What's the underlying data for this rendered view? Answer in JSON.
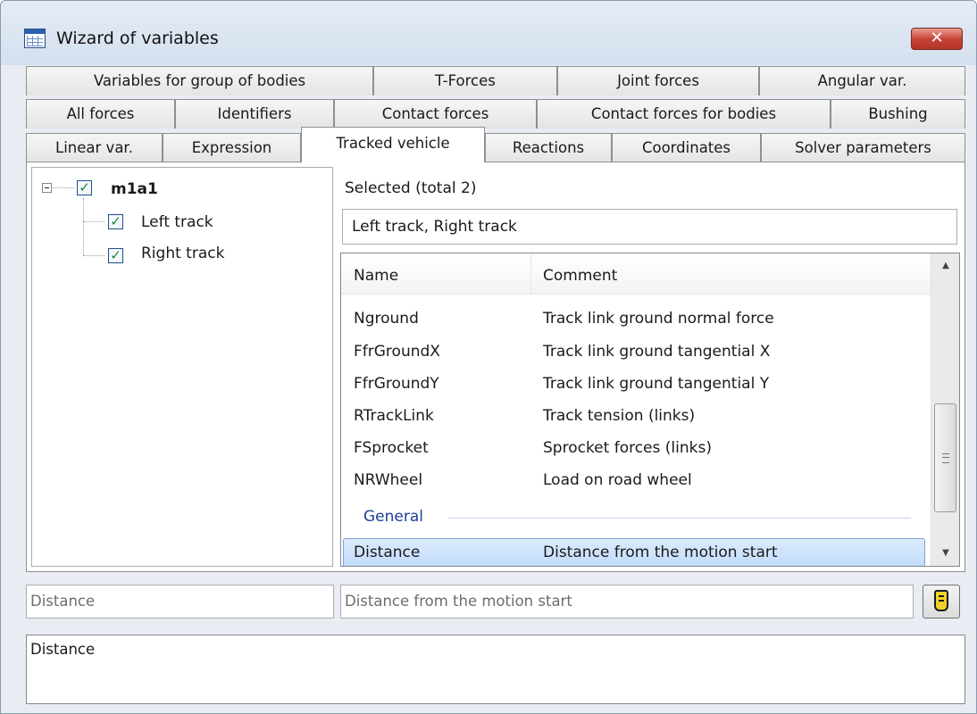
{
  "window": {
    "title": "Wizard of variables",
    "close_glyph": "✕"
  },
  "tabs": {
    "row1": [
      "Variables for group of bodies",
      "T-Forces",
      "Joint forces",
      "Angular var."
    ],
    "row2": [
      "All forces",
      "Identifiers",
      "Contact forces",
      "Contact forces for bodies",
      "Bushing"
    ],
    "row3": [
      "Linear var.",
      "Expression",
      "Tracked vehicle",
      "Reactions",
      "Coordinates",
      "Solver parameters"
    ],
    "active": "Tracked vehicle"
  },
  "tree": {
    "root": {
      "label": "m1a1",
      "checked": true,
      "expander": "minus"
    },
    "children": [
      {
        "label": "Left track",
        "checked": true
      },
      {
        "label": "Right track",
        "checked": true
      }
    ]
  },
  "selection": {
    "label": "Selected (total 2)",
    "value": "Left track, Right track"
  },
  "list": {
    "columns": [
      "Name",
      "Comment"
    ],
    "rows": [
      {
        "name": "Nground",
        "comment": "Track link ground normal force"
      },
      {
        "name": "FfrGroundX",
        "comment": "Track link ground tangential X"
      },
      {
        "name": "FfrGroundY",
        "comment": "Track link ground tangential Y"
      },
      {
        "name": "RTrackLink",
        "comment": "Track tension (links)"
      },
      {
        "name": "FSprocket",
        "comment": "Sprocket forces (links)"
      },
      {
        "name": "NRWheel",
        "comment": "Load on road wheel"
      }
    ],
    "group": "General",
    "selected_row": {
      "name": "Distance",
      "comment": "Distance from the motion start"
    }
  },
  "fields": {
    "name_value": "Distance",
    "comment_value": "Distance from the motion start",
    "expression_value": "Distance"
  },
  "icons": {
    "app": "table-grid-icon",
    "pick": "pick-variable-icon",
    "scroll_up": "▲",
    "scroll_down": "▼"
  },
  "colors": {
    "selection_bg": "#c8defb",
    "group_header": "#1e3e9a",
    "check_mark": "#1c8a32",
    "close_button": "#c8453a"
  }
}
